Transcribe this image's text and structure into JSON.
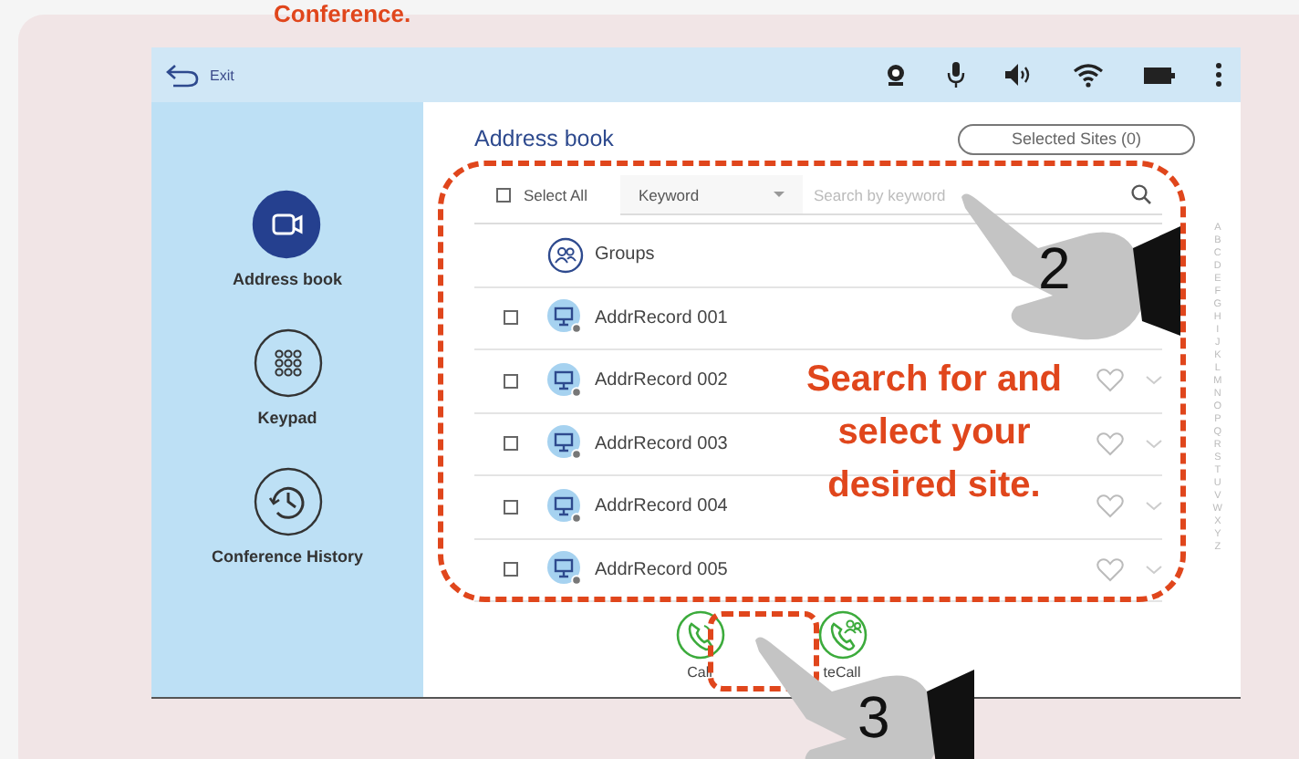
{
  "heading": "Conference.",
  "top_bar": {
    "exit_label": "Exit"
  },
  "sidebar": {
    "items": [
      {
        "label": "Address book",
        "kind": "camera",
        "selected": true
      },
      {
        "label": "Keypad",
        "kind": "keypad",
        "selected": false
      },
      {
        "label": "Conference History",
        "kind": "history",
        "selected": false
      }
    ]
  },
  "main": {
    "title": "Address book",
    "selected_sites_button": "Selected Sites (0)",
    "select_all": {
      "label": "Select All",
      "checked": false
    },
    "filter_dropdown": "Keyword",
    "search": {
      "placeholder": "Search by keyword"
    },
    "groups_row": "Groups",
    "records": [
      {
        "name": "AddrRecord 001",
        "checked": false
      },
      {
        "name": "AddrRecord 002",
        "checked": false
      },
      {
        "name": "AddrRecord 003",
        "checked": false
      },
      {
        "name": "AddrRecord 004",
        "checked": false
      },
      {
        "name": "AddrRecord 005",
        "checked": false
      }
    ],
    "index_letters": [
      "A",
      "B",
      "C",
      "D",
      "E",
      "F",
      "G",
      "H",
      "I",
      "J",
      "K",
      "L",
      "M",
      "N",
      "O",
      "P",
      "Q",
      "R",
      "S",
      "T",
      "U",
      "V",
      "W",
      "X",
      "Y",
      "Z"
    ],
    "actions": [
      {
        "label": "Call",
        "kind": "call"
      },
      {
        "label": "teCall",
        "kind": "group-call"
      }
    ]
  },
  "annotations": {
    "callout": "Search for and select your desired site.",
    "steps": [
      "2",
      "3"
    ]
  }
}
